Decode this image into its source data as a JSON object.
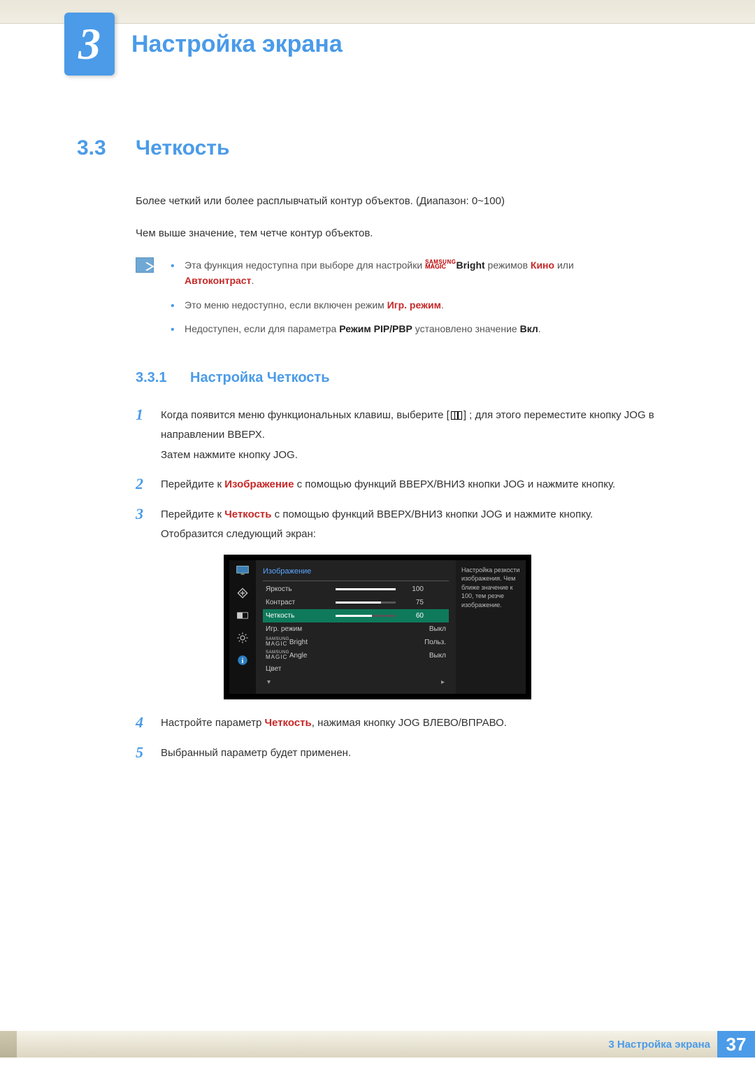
{
  "chapter": {
    "number": "3",
    "title": "Настройка экрана"
  },
  "section": {
    "number": "3.3",
    "title": "Четкость"
  },
  "intro": {
    "p1": "Более четкий или более расплывчатый контур объектов. (Диапазон: 0~100)",
    "p2": "Чем выше значение, тем четче контур объектов."
  },
  "notes": {
    "samsung_top": "SAMSUNG",
    "samsung_bot": "MAGIC",
    "n1_a": "Эта функция недоступна при выборе для настройки ",
    "n1_bright": "Bright",
    "n1_b": " режимов ",
    "n1_cinema": "Кино",
    "n1_c": " или ",
    "n1_auto": "Автоконтраст",
    "n1_d": ".",
    "n2_a": "Это меню недоступно, если включен режим ",
    "n2_game": "Игр. режим",
    "n2_b": ".",
    "n3_a": "Недоступен, если для параметра ",
    "n3_pip": "Режим PIP/PBP",
    "n3_b": " установлено значение ",
    "n3_on": "Вкл",
    "n3_c": "."
  },
  "subsection": {
    "number": "3.3.1",
    "title": "Настройка Четкость"
  },
  "steps": {
    "s1_a": "Когда появится меню функциональных клавиш, выберите [",
    "s1_b": "] ; для этого переместите кнопку JOG в направлении ВВЕРХ.",
    "s1_c": "Затем нажмите кнопку JOG.",
    "s2_a": "Перейдите к ",
    "s2_img": "Изображение",
    "s2_b": " с помощью функций ВВЕРХ/ВНИЗ кнопки JOG и нажмите кнопку.",
    "s3_a": "Перейдите к ",
    "s3_sharp": "Четкость",
    "s3_b": " с помощью функций ВВЕРХ/ВНИЗ кнопки JOG и нажмите кнопку.",
    "s3_c": "Отобразится следующий экран:",
    "n1": "1",
    "n2": "2",
    "n3": "3",
    "n4": "4",
    "n5": "5",
    "s4_a": "Настройте параметр ",
    "s4_sharp": "Четкость",
    "s4_b": ", нажимая кнопку JOG ВЛЕВО/ВПРАВО.",
    "s5": "Выбранный параметр будет применен."
  },
  "osd": {
    "title": "Изображение",
    "desc": "Настройка резкости изображения. Чем ближе значение к 100, тем резче изображение.",
    "items": [
      {
        "label": "Яркость",
        "value": "100",
        "fill": 100,
        "bar": true
      },
      {
        "label": "Контраст",
        "value": "75",
        "fill": 75,
        "bar": true
      },
      {
        "label": "Четкость",
        "value": "60",
        "fill": 60,
        "bar": true,
        "selected": true
      },
      {
        "label": "Игр. режим",
        "value": "Выкл",
        "bar": false
      },
      {
        "label": "_MAGICBright",
        "value": "Польз.",
        "bar": false,
        "magic": "Bright"
      },
      {
        "label": "_MAGICAngle",
        "value": "Выкл",
        "bar": false,
        "magic": "Angle"
      },
      {
        "label": "Цвет",
        "value": "",
        "bar": false
      }
    ],
    "arrow_down": "▾",
    "arrow_right": "▸"
  },
  "footer": {
    "text": "3 Настройка экрана",
    "page": "37"
  }
}
